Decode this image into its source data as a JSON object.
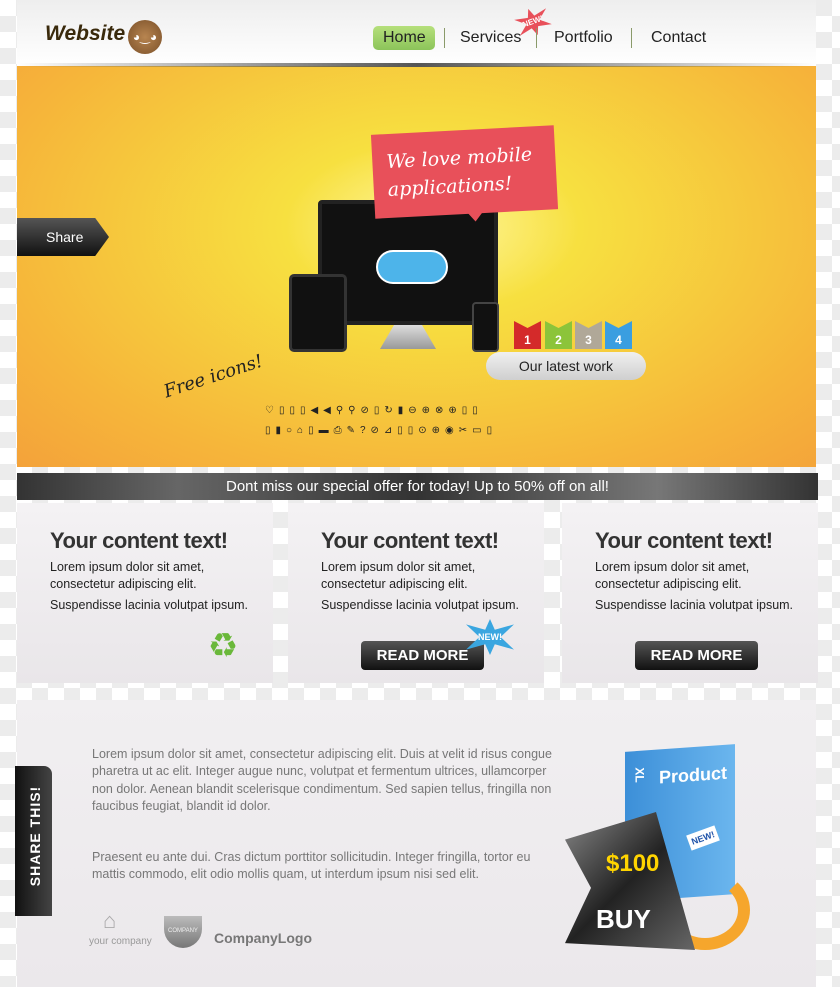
{
  "header": {
    "logo": "Website",
    "nav": [
      {
        "label": "Home",
        "active": true
      },
      {
        "label": "Services"
      },
      {
        "label": "Portfolio"
      },
      {
        "label": "Contact"
      }
    ],
    "new_badge": "NEW!",
    "accent": "#8cc45a"
  },
  "hero": {
    "share": "Share",
    "bubble": "We love mobile applications!",
    "flags": [
      "1",
      "2",
      "3",
      "4"
    ],
    "flag_colors": [
      "#d42a2a",
      "#8cc43a",
      "#b0a898",
      "#3a9ee0"
    ],
    "latest": "Our latest work",
    "free_icons": "Free icons!",
    "icons_row1": "♡▯▯▯◀◀⚲⚲⊘▯↻▮⊖⊕⊗⊕▯▯",
    "icons_row2": "▯▮○⌂▯▬⎙✎?⊘⊿▯▯⊙⊕◉✂▭▯"
  },
  "offer": "Dont miss our special offer for today! Up to 50% off on all!",
  "cards": [
    {
      "title": "Your content text!",
      "line1": "Lorem ipsum dolor sit amet, consectetur adipiscing elit.",
      "line2": "Suspendisse lacinia volutpat ipsum."
    },
    {
      "title": "Your content text!",
      "line1": "Lorem ipsum dolor sit amet, consectetur adipiscing elit.",
      "line2": "Suspendisse lacinia volutpat ipsum.",
      "button": "READ MORE",
      "badge": "NEW!"
    },
    {
      "title": "Your content text!",
      "line1": "Lorem ipsum dolor sit amet, consectetur adipiscing elit.",
      "line2": "Suspendisse lacinia volutpat ipsum.",
      "button": "READ MORE"
    }
  ],
  "bottom": {
    "share": "SHARE THIS!",
    "para1": "Lorem ipsum dolor sit amet, consectetur adipiscing elit. Duis at velit id risus congue pharetra ut ac elit. Integer augue nunc, volutpat et fermentum ultrices, ullamcorper non dolor. Aenean blandit scelerisque condimentum. Sed sapien tellus, fringilla non faucibus feugiat, blandit id dolor.",
    "para2": "Praesent eu ante dui. Cras dictum porttitor sollicitudin. Integer fringilla, tortor eu mattis commodo, elit odio mollis quam, ut interdum ipsum nisi sed elit.",
    "logo1": "your company",
    "logo2": "COMPANY",
    "logo3": "CompanyLogo",
    "product": "Product",
    "product_xl": "XL",
    "product_badge": "NEW!",
    "price": "$100",
    "buy": "BUY"
  }
}
